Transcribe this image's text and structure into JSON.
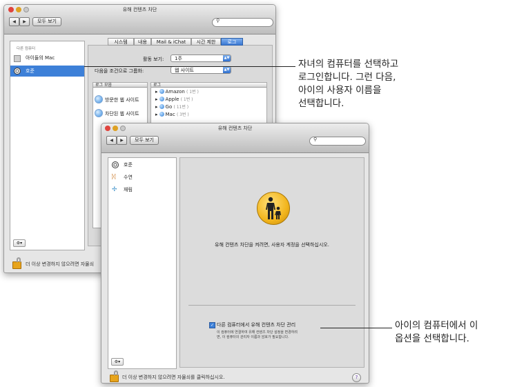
{
  "back_window": {
    "title": "유해 컨텐츠 차단",
    "nav_back": "◀",
    "nav_forward": "▶",
    "show_all": "모두 보기",
    "sidebar_header": "다른 컴퓨터",
    "sidebar_computer": "아이들의 Mac",
    "sidebar_user": "호준",
    "tabs": [
      "시스템",
      "내용",
      "Mail & iChat",
      "시간 제한",
      "로그"
    ],
    "selected_tab": "로그",
    "activity_label": "활동 보기:",
    "activity_value": "1주",
    "group_label": "다음을 조건으로 그룹화:",
    "group_value": "웹 사이트",
    "collections_header": "로그 모음",
    "logs_header": "로그",
    "collections": [
      "방문한 웹 사이트",
      "차단된 웹 사이트"
    ],
    "logs": [
      {
        "name": "Amazon",
        "count": "( 1번 )"
      },
      {
        "name": "Apple",
        "count": "( 1번 )"
      },
      {
        "name": "Go",
        "count": "( 11번 )"
      },
      {
        "name": "Mac",
        "count": "( 3번 )"
      }
    ],
    "lock_text": "더 이상 변경하지 않으려면 자물쇠"
  },
  "front_window": {
    "title": "유해 컨텐츠 차단",
    "nav_back": "◀",
    "nav_forward": "▶",
    "show_all": "모두 보기",
    "users": [
      "호준",
      "수연",
      "재림"
    ],
    "message": "유해 컨텐츠 차단을 켜려면, 사용자 계정을 선택하십시오.",
    "checkbox_label": "다른 컴퓨터에서 유해 컨텐츠 차단 관리",
    "checkbox_checked": true,
    "checkbox_desc_1": "이 컴퓨터에 연결하여 유해 컨텐츠 차단 설정을 변경하려",
    "checkbox_desc_2": "면, 이 컴퓨터의 관리자 이름과 암호가 필요합니다.",
    "lock_text": "더 이상 변경하지 않으려면 자물쇠를 클릭하십시오.",
    "help": "?"
  },
  "callouts": {
    "top": [
      "자녀의 컴퓨터를 선택하고",
      "로그인합니다. 그런 다음,",
      "아이의 사용자 이름을",
      "선택합니다."
    ],
    "bottom": [
      "아이의 컴퓨터에서 이",
      "옵션을 선택합니다."
    ]
  },
  "colors": {
    "selection": "#3d80d8",
    "parental_icon": "#f2b51d",
    "lock": "#e7a41c"
  }
}
